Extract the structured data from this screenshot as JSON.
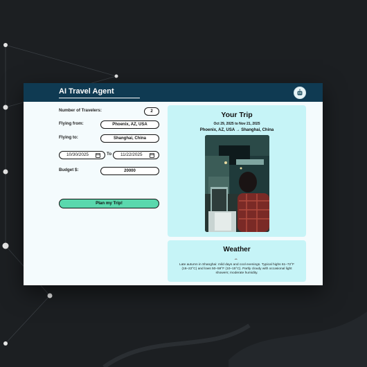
{
  "app": {
    "title": "AI Travel Agent"
  },
  "form": {
    "travelers": {
      "label": "Number of Travelers:",
      "value": "2"
    },
    "from": {
      "label": "Flying from:",
      "value": "Phoenix, AZ, USA"
    },
    "to": {
      "label": "Flying to:",
      "value": "Shanghai, China"
    },
    "dates": {
      "start": "10/30/2025",
      "separator": "To",
      "end": "11/22/2025"
    },
    "budget": {
      "label": "Budget $:",
      "value": "20000"
    },
    "submit_label": "Plan my Trip!"
  },
  "trip": {
    "title": "Your Trip",
    "dates": "Oct 29, 2025 to Nov 21, 2025",
    "route": "Phoenix, AZ, USA → Shanghai, China"
  },
  "weather": {
    "title": "Weather",
    "icon": "cloud-icon",
    "description": "Late autumn in Shanghai: mild days and cool evenings. Typical highs 61–72°F (16–22°C) and lows 50–59°F (10–15°C). Partly cloudy with occasional light showers; moderate humidity."
  },
  "colors": {
    "header": "#0f3a52",
    "page_bg": "#f4fbfd",
    "card": "#c6f4f7",
    "button": "#5ad8ad",
    "backdrop": "#1c1f22"
  }
}
